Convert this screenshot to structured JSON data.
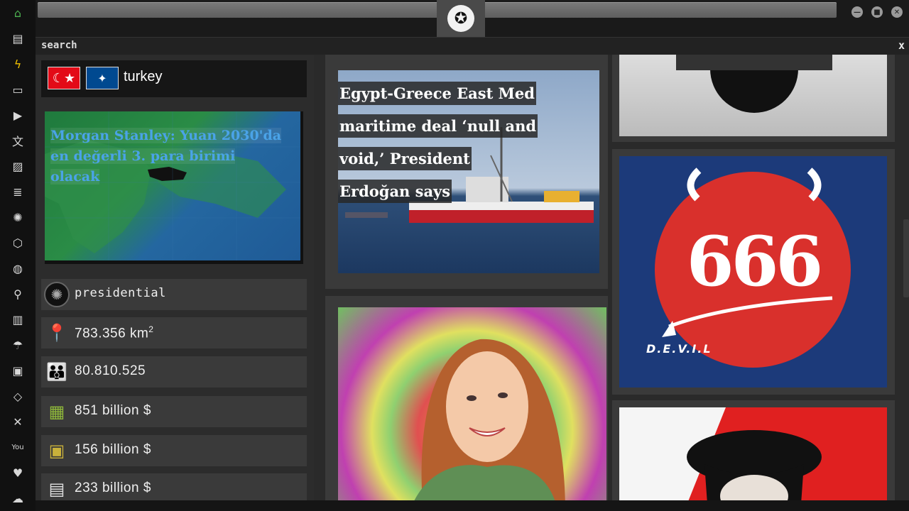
{
  "search": {
    "label": "search",
    "close": "x"
  },
  "country": {
    "name": "turkey"
  },
  "left_news": {
    "title": "Morgan Stanley: Yuan 2030'da en değerli 3. para birimi olacak"
  },
  "stats": [
    {
      "icon": "empire-icon",
      "text": "presidential"
    },
    {
      "icon": "map-pin-icon",
      "text": "783.356 km",
      "sup": "2"
    },
    {
      "icon": "people-icon",
      "text": "80.810.525"
    },
    {
      "icon": "money-icon",
      "text": "851 billion $"
    },
    {
      "icon": "forklift-icon",
      "text": "156 billion $"
    },
    {
      "icon": "boxes-icon",
      "text": "233 billion $"
    }
  ],
  "mid_news": {
    "title": "Egypt-Greece East Med maritime deal ‘null and void,’ President Erdoğan says"
  },
  "right_images": {
    "devil_text": "666",
    "devil_caption": "D.E.V.I.L"
  },
  "colors": {
    "accent": "#4caf50",
    "news_link": "#4aa3e8",
    "devil_red": "#d9302c",
    "devil_blue": "#1c3a7a"
  }
}
